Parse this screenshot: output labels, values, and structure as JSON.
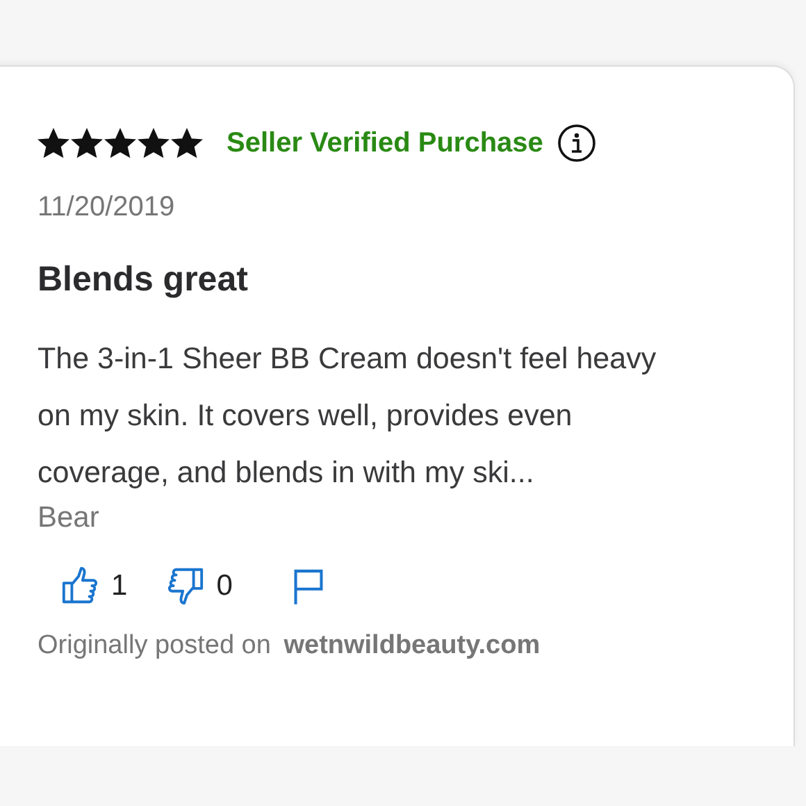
{
  "review": {
    "stars": 5,
    "badge": "Seller Verified Purchase",
    "date": "11/20/2019",
    "title": "Blends great",
    "body": "The 3-in-1 Sheer BB Cream doesn't feel heavy on my skin. It covers well, provides even coverage, and blends in with my ski...",
    "author": "Bear",
    "helpful": "1",
    "not_helpful": "0",
    "source": "Originally posted on **wetnwildbeauty.com**"
  }
}
